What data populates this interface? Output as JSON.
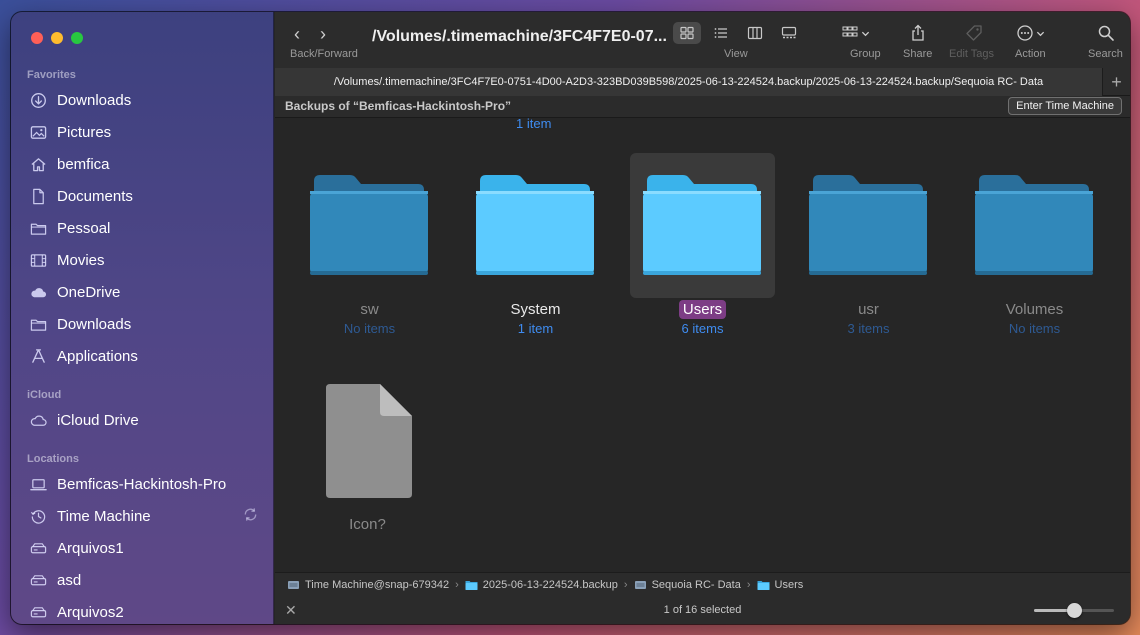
{
  "sidebar": {
    "favorites_label": "Favorites",
    "favorites": [
      {
        "label": "Downloads",
        "icon": "download-icon"
      },
      {
        "label": "Pictures",
        "icon": "pictures-icon"
      },
      {
        "label": "bemfica",
        "icon": "home-icon"
      },
      {
        "label": "Documents",
        "icon": "document-icon"
      },
      {
        "label": "Pessoal",
        "icon": "folder-icon"
      },
      {
        "label": "Movies",
        "icon": "film-icon"
      },
      {
        "label": "OneDrive",
        "icon": "cloud-icon"
      },
      {
        "label": "Downloads",
        "icon": "folder-icon"
      },
      {
        "label": "Applications",
        "icon": "applications-icon"
      }
    ],
    "icloud_label": "iCloud",
    "icloud": [
      {
        "label": "iCloud Drive",
        "icon": "icloud-icon"
      }
    ],
    "locations_label": "Locations",
    "locations": [
      {
        "label": "Bemficas-Hackintosh-Pro",
        "icon": "laptop-icon"
      },
      {
        "label": "Time Machine",
        "icon": "time-machine-icon"
      },
      {
        "label": "Arquivos1",
        "icon": "drive-icon"
      },
      {
        "label": "asd",
        "icon": "drive-icon"
      },
      {
        "label": "Arquivos2",
        "icon": "drive-icon"
      }
    ]
  },
  "toolbar": {
    "back_forward_label": "Back/Forward",
    "title": "/Volumes/.timemachine/3FC4F7E0-07...",
    "view_label": "View",
    "group_label": "Group",
    "share_label": "Share",
    "edit_tags_label": "Edit Tags",
    "action_label": "Action",
    "search_label": "Search"
  },
  "pathbar": {
    "path": "/Volumes/.timemachine/3FC4F7E0-0751-4D00-A2D3-323BD039B598/2025-06-13-224524.backup/2025-06-13-224524.backup/Sequoia RC- Data",
    "plus": "+"
  },
  "infobar": {
    "label": "Backups of “Bemficas-Hackintosh-Pro”",
    "button": "Enter Time Machine"
  },
  "content": {
    "partial_row_subtitle": "1 item",
    "items": [
      {
        "name": "sw",
        "subtitle": "No items",
        "dim": true,
        "selected": false
      },
      {
        "name": "System",
        "subtitle": "1 item",
        "dim": false,
        "selected": false
      },
      {
        "name": "Users",
        "subtitle": "6 items",
        "dim": false,
        "selected": true
      },
      {
        "name": "usr",
        "subtitle": "3 items",
        "dim": true,
        "selected": false
      },
      {
        "name": "Volumes",
        "subtitle": "No items",
        "dim": true,
        "selected": false
      }
    ],
    "doc": {
      "name": "Icon?"
    }
  },
  "breadcrumb": [
    {
      "label": "Time Machine@snap-679342",
      "icon": "disk-icon"
    },
    {
      "label": "2025-06-13-224524.backup",
      "icon": "folder-icon"
    },
    {
      "label": "Sequoia RC- Data",
      "icon": "disk-icon"
    },
    {
      "label": "Users",
      "icon": "folder-icon"
    }
  ],
  "status": {
    "text": "1 of 16 selected",
    "icon_size_fraction": 0.5
  },
  "colors": {
    "accent": "#3f8cf0",
    "selection": "#7d3d85",
    "folder_light": "#5ccbff",
    "folder_dim": "#2f86b8"
  }
}
